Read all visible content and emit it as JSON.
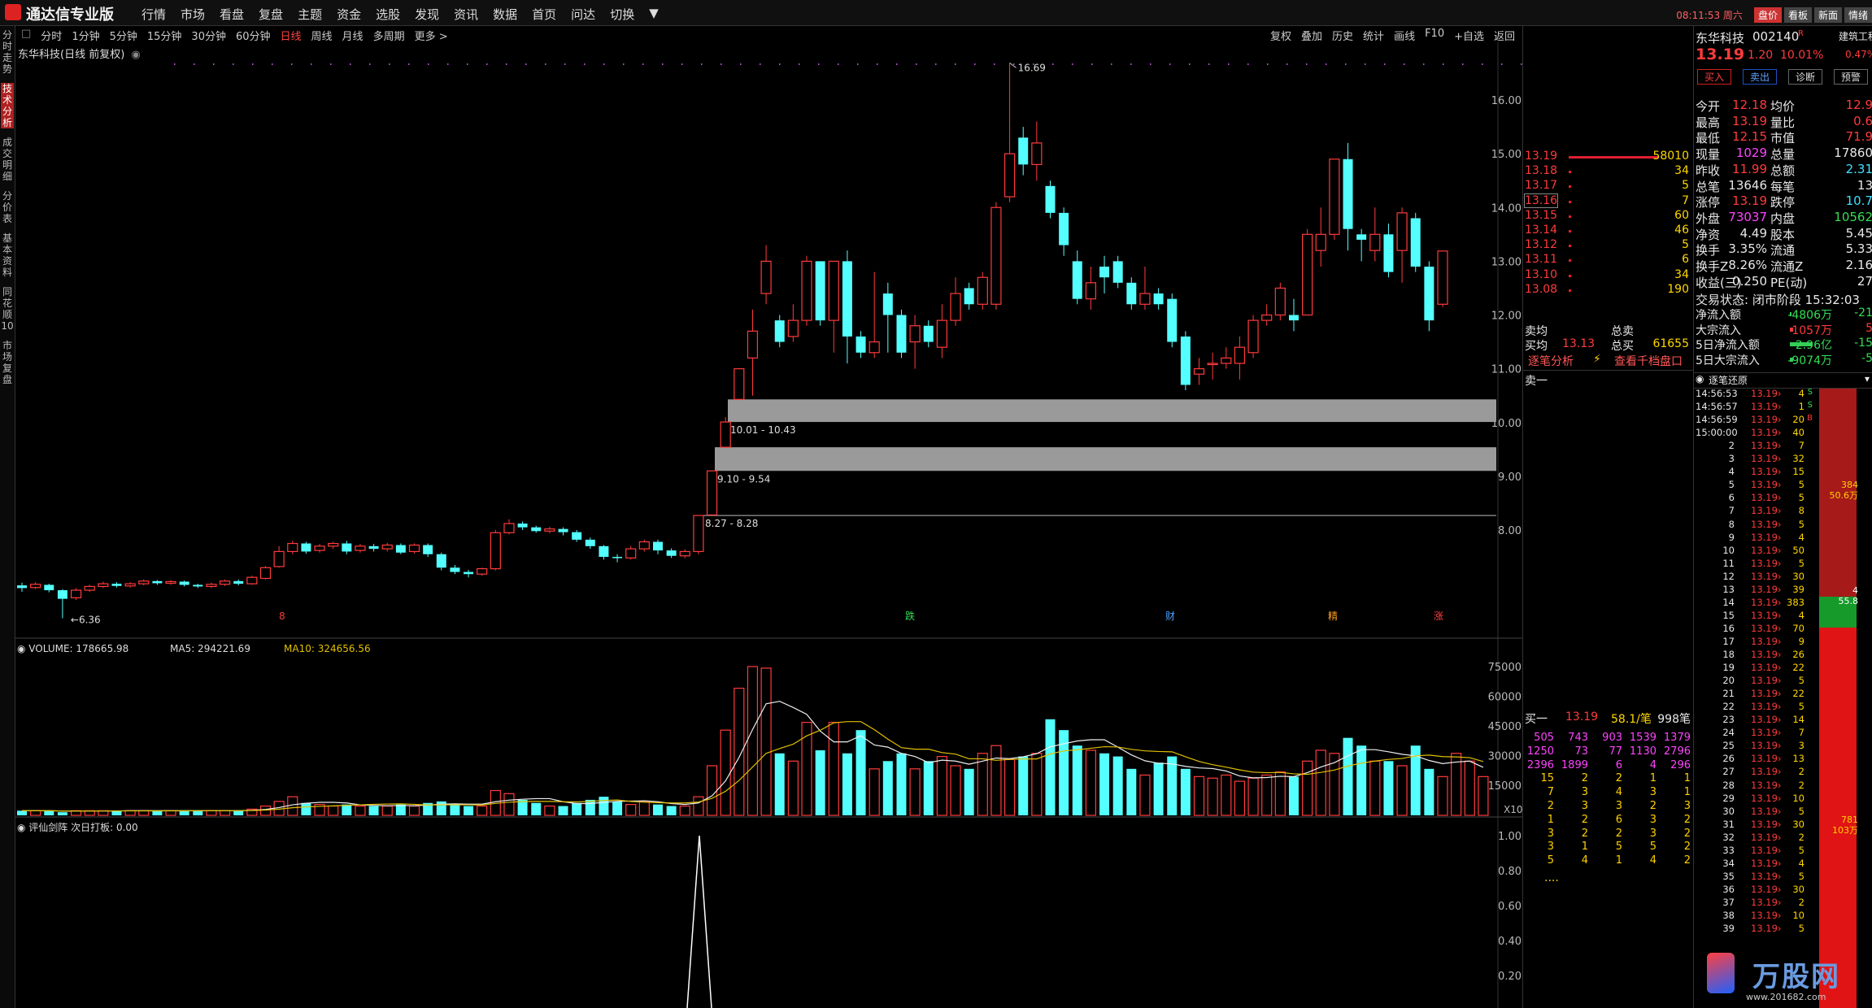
{
  "app": {
    "title": "通达信专业版",
    "menu": [
      "行情",
      "市场",
      "看盘",
      "复盘",
      "主题",
      "资金",
      "选股",
      "发现",
      "资讯",
      "数据",
      "首页",
      "问达",
      "切换",
      "▼"
    ],
    "clock": "08:11:53 周六",
    "top_buttons": [
      "盘价",
      "看板",
      "新面",
      "情绪"
    ]
  },
  "left_tabs": [
    "分时走势",
    "技术分析",
    "成交明细",
    "分价表",
    "基本资料",
    "同花顺10",
    "市场复盘"
  ],
  "periods": [
    "分时",
    "1分钟",
    "5分钟",
    "15分钟",
    "30分钟",
    "60分钟",
    "日线",
    "周线",
    "月线",
    "多周期",
    "更多 >"
  ],
  "active_period": "日线",
  "tools": [
    "复权",
    "叠加",
    "历史",
    "统计",
    "画线",
    "F10",
    "+自选",
    "返回"
  ],
  "chart_title": "东华科技(日线 前复权)",
  "price_axis": [
    "16.00",
    "15.00",
    "14.00",
    "13.00",
    "12.00",
    "11.00",
    "10.00",
    "9.00",
    "8.00"
  ],
  "annotations": {
    "high": "16.69",
    "low": "6.36",
    "gap1": "10.01 - 10.43",
    "gap2": "9.10 - 9.54",
    "gap3": "8.27 - 8.28"
  },
  "event_marks": [
    "8",
    "跌",
    "财",
    "精",
    "涨"
  ],
  "volume": {
    "legend_name": "VOLUME: 178665.98",
    "legend_ma5": "MA5: 294221.69",
    "legend_ma10": "MA10: 324656.56",
    "axis": [
      "75000",
      "60000",
      "45000",
      "30000",
      "15000"
    ],
    "unit": "X10"
  },
  "indicator": {
    "legend": "评仙剑阵  次日打板: 0.00",
    "axis": [
      "1.00",
      "0.80",
      "0.60",
      "0.40",
      "0.20"
    ]
  },
  "quote": {
    "name": "东华科技",
    "code": "002140",
    "code_mark": "R",
    "sector": "建筑工程",
    "price": "13.19",
    "change": "1.20",
    "pct": "10.01%",
    "extra_pct": "0.47%",
    "buttons": [
      "买入",
      "卖出",
      "诊断",
      "预警"
    ],
    "sell_levels": [
      {
        "price": "13.19",
        "vol": "58010"
      },
      {
        "price": "13.18",
        "vol": "34"
      },
      {
        "price": "13.17",
        "vol": "5"
      },
      {
        "price": "13.16",
        "vol": "7"
      },
      {
        "price": "13.15",
        "vol": "60"
      },
      {
        "price": "13.14",
        "vol": "46"
      },
      {
        "price": "13.12",
        "vol": "5"
      },
      {
        "price": "13.11",
        "vol": "6"
      },
      {
        "price": "13.10",
        "vol": "34"
      },
      {
        "price": "13.08",
        "vol": "190"
      }
    ],
    "sell_avg_label": "卖均",
    "sell_total_label": "总卖",
    "buy_avg_label": "买均",
    "buy_avg": "13.13",
    "buy_total_label": "总买",
    "buy_total": "61655",
    "link1": "逐笔分析",
    "link2": "查看千档盘口",
    "ask1_label": "卖一",
    "bid1": {
      "label": "买一",
      "price": "13.19",
      "avg": "58.1/笔",
      "count": "998笔"
    },
    "queue": [
      [
        "505",
        "743",
        "903",
        "1539",
        "1379"
      ],
      [
        "1250",
        "73",
        "77",
        "1130",
        "2796"
      ],
      [
        "2396",
        "1899",
        "6",
        "4",
        "296"
      ],
      [
        "15",
        "2",
        "2",
        "1",
        "1"
      ],
      [
        "7",
        "3",
        "4",
        "3",
        "1"
      ],
      [
        "2",
        "3",
        "3",
        "2",
        "3"
      ],
      [
        "1",
        "2",
        "6",
        "3",
        "2"
      ],
      [
        "3",
        "2",
        "2",
        "3",
        "2"
      ],
      [
        "3",
        "1",
        "5",
        "5",
        "2"
      ],
      [
        "5",
        "4",
        "1",
        "4",
        "2"
      ]
    ],
    "more": "....",
    "stats": [
      {
        "l1": "今开",
        "v1": "12.18",
        "l2": "均价",
        "v2": "12.9"
      },
      {
        "l1": "最高",
        "v1": "13.19",
        "l2": "量比",
        "v2": "0.6"
      },
      {
        "l1": "最低",
        "v1": "12.15",
        "l2": "市值",
        "v2": "71.9"
      },
      {
        "l1": "现量",
        "v1": "1029",
        "l2": "总量",
        "v2": "17860"
      },
      {
        "l1": "昨收",
        "v1": "11.99",
        "l2": "总额",
        "v2": "2.31"
      },
      {
        "l1": "总笔",
        "v1": "13646",
        "l2": "每笔",
        "v2": "13"
      },
      {
        "l1": "涨停",
        "v1": "13.19",
        "l2": "跌停",
        "v2": "10.7"
      },
      {
        "l1": "外盘",
        "v1": "73037",
        "l2": "内盘",
        "v2": "10562"
      },
      {
        "l1": "净资",
        "v1": "4.49",
        "l2": "股本",
        "v2": "5.45"
      },
      {
        "l1": "换手",
        "v1": "3.35%",
        "l2": "流通",
        "v2": "5.33"
      },
      {
        "l1": "换手Z",
        "v1": "8.26%",
        "l2": "流通Z",
        "v2": "2.16"
      },
      {
        "l1": "收益(三)",
        "v1": "0.250",
        "l2": "PE(动)",
        "v2": "27"
      }
    ],
    "trade_status": "交易状态: 闭市阶段 15:32:03",
    "flows": [
      {
        "label": "净流入额",
        "v1": "-4806万",
        "v2": "-21"
      },
      {
        "label": "大宗流入",
        "v1": "1057万",
        "v2": "5"
      },
      {
        "label": "5日净流入额",
        "v1": "-2.96亿",
        "v2": "-15"
      },
      {
        "label": "5日大宗流入",
        "v1": "-9074万",
        "v2": "-5"
      }
    ]
  },
  "ticks": {
    "title": "逐笔还原",
    "rows": [
      [
        "14:56:53",
        "13.19",
        "4",
        "S"
      ],
      [
        "14:56:57",
        "13.19",
        "1",
        "S"
      ],
      [
        "14:56:59",
        "13.19",
        "20",
        "B"
      ],
      [
        "15:00:00",
        "13.19",
        "40",
        ""
      ],
      [
        "2",
        "13.19",
        "7",
        ""
      ],
      [
        "3",
        "13.19",
        "32",
        ""
      ],
      [
        "4",
        "13.19",
        "15",
        ""
      ],
      [
        "5",
        "13.19",
        "5",
        ""
      ],
      [
        "6",
        "13.19",
        "5",
        ""
      ],
      [
        "7",
        "13.19",
        "8",
        ""
      ],
      [
        "8",
        "13.19",
        "5",
        ""
      ],
      [
        "9",
        "13.19",
        "4",
        ""
      ],
      [
        "10",
        "13.19",
        "50",
        ""
      ],
      [
        "11",
        "13.19",
        "5",
        ""
      ],
      [
        "12",
        "13.19",
        "30",
        ""
      ],
      [
        "13",
        "13.19",
        "39",
        ""
      ],
      [
        "14",
        "13.19",
        "383",
        ""
      ],
      [
        "15",
        "13.19",
        "4",
        ""
      ],
      [
        "16",
        "13.19",
        "70",
        ""
      ],
      [
        "17",
        "13.19",
        "9",
        ""
      ],
      [
        "18",
        "13.19",
        "26",
        ""
      ],
      [
        "19",
        "13.19",
        "22",
        ""
      ],
      [
        "20",
        "13.19",
        "5",
        ""
      ],
      [
        "21",
        "13.19",
        "22",
        ""
      ],
      [
        "22",
        "13.19",
        "5",
        ""
      ],
      [
        "23",
        "13.19",
        "14",
        ""
      ],
      [
        "24",
        "13.19",
        "7",
        ""
      ],
      [
        "25",
        "13.19",
        "3",
        ""
      ],
      [
        "26",
        "13.19",
        "13",
        ""
      ],
      [
        "27",
        "13.19",
        "2",
        ""
      ],
      [
        "28",
        "13.19",
        "2",
        ""
      ],
      [
        "29",
        "13.19",
        "10",
        ""
      ],
      [
        "30",
        "13.19",
        "5",
        ""
      ],
      [
        "31",
        "13.19",
        "30",
        ""
      ],
      [
        "32",
        "13.19",
        "2",
        ""
      ],
      [
        "33",
        "13.19",
        "5",
        ""
      ],
      [
        "34",
        "13.19",
        "4",
        ""
      ],
      [
        "35",
        "13.19",
        "5",
        ""
      ],
      [
        "36",
        "13.19",
        "30",
        ""
      ],
      [
        "37",
        "13.19",
        "2",
        ""
      ],
      [
        "38",
        "13.19",
        "10",
        ""
      ],
      [
        "39",
        "13.19",
        "5",
        ""
      ]
    ],
    "bar_labels": [
      {
        "v": "384",
        "s": "50.6万"
      },
      {
        "v": "4",
        "s": "55.8"
      },
      {
        "v": "781",
        "s": "103万"
      }
    ],
    "watermark": "万股网",
    "watermark_url": "www.201682.com"
  },
  "candles": [
    {
      "o": 6.97,
      "c": 6.92,
      "h": 7.02,
      "l": 6.85
    },
    {
      "o": 6.93,
      "c": 6.99,
      "h": 7.03,
      "l": 6.9
    },
    {
      "o": 6.98,
      "c": 6.88,
      "h": 7.0,
      "l": 6.84
    },
    {
      "o": 6.88,
      "c": 6.72,
      "h": 6.9,
      "l": 6.36
    },
    {
      "o": 6.74,
      "c": 6.88,
      "h": 6.92,
      "l": 6.7
    },
    {
      "o": 6.88,
      "c": 6.95,
      "h": 6.98,
      "l": 6.85
    },
    {
      "o": 6.95,
      "c": 7.0,
      "h": 7.04,
      "l": 6.92
    },
    {
      "o": 7.0,
      "c": 6.96,
      "h": 7.03,
      "l": 6.93
    },
    {
      "o": 6.96,
      "c": 7.0,
      "h": 7.03,
      "l": 6.93
    },
    {
      "o": 7.0,
      "c": 7.05,
      "h": 7.08,
      "l": 6.97
    },
    {
      "o": 7.05,
      "c": 7.01,
      "h": 7.07,
      "l": 6.98
    },
    {
      "o": 7.01,
      "c": 7.04,
      "h": 7.07,
      "l": 6.98
    },
    {
      "o": 7.04,
      "c": 6.98,
      "h": 7.06,
      "l": 6.95
    },
    {
      "o": 6.98,
      "c": 6.95,
      "h": 7.0,
      "l": 6.92
    },
    {
      "o": 6.95,
      "c": 6.99,
      "h": 7.02,
      "l": 6.92
    },
    {
      "o": 6.99,
      "c": 7.05,
      "h": 7.08,
      "l": 6.96
    },
    {
      "o": 7.05,
      "c": 7.0,
      "h": 7.08,
      "l": 6.97
    },
    {
      "o": 7.0,
      "c": 7.12,
      "h": 7.15,
      "l": 6.98
    },
    {
      "o": 7.1,
      "c": 7.3,
      "h": 7.33,
      "l": 7.08
    },
    {
      "o": 7.32,
      "c": 7.6,
      "h": 7.7,
      "l": 7.3
    },
    {
      "o": 7.6,
      "c": 7.75,
      "h": 7.8,
      "l": 7.55
    },
    {
      "o": 7.75,
      "c": 7.6,
      "h": 7.78,
      "l": 7.56
    },
    {
      "o": 7.62,
      "c": 7.7,
      "h": 7.74,
      "l": 7.58
    },
    {
      "o": 7.7,
      "c": 7.75,
      "h": 7.78,
      "l": 7.65
    },
    {
      "o": 7.75,
      "c": 7.6,
      "h": 7.8,
      "l": 7.55
    },
    {
      "o": 7.62,
      "c": 7.7,
      "h": 7.74,
      "l": 7.58
    },
    {
      "o": 7.7,
      "c": 7.65,
      "h": 7.74,
      "l": 7.6
    },
    {
      "o": 7.65,
      "c": 7.72,
      "h": 7.76,
      "l": 7.6
    },
    {
      "o": 7.72,
      "c": 7.58,
      "h": 7.75,
      "l": 7.55
    },
    {
      "o": 7.6,
      "c": 7.72,
      "h": 7.75,
      "l": 7.56
    },
    {
      "o": 7.72,
      "c": 7.55,
      "h": 7.75,
      "l": 7.5
    },
    {
      "o": 7.55,
      "c": 7.3,
      "h": 7.58,
      "l": 7.25
    },
    {
      "o": 7.3,
      "c": 7.22,
      "h": 7.35,
      "l": 7.18
    },
    {
      "o": 7.22,
      "c": 7.18,
      "h": 7.26,
      "l": 7.12
    },
    {
      "o": 7.18,
      "c": 7.28,
      "h": 7.3,
      "l": 7.15
    },
    {
      "o": 7.28,
      "c": 7.95,
      "h": 8.0,
      "l": 7.25
    },
    {
      "o": 7.95,
      "c": 8.12,
      "h": 8.2,
      "l": 7.92
    },
    {
      "o": 8.12,
      "c": 8.05,
      "h": 8.16,
      "l": 8.0
    },
    {
      "o": 8.05,
      "c": 7.98,
      "h": 8.08,
      "l": 7.95
    },
    {
      "o": 7.98,
      "c": 8.02,
      "h": 8.06,
      "l": 7.94
    },
    {
      "o": 8.02,
      "c": 7.96,
      "h": 8.05,
      "l": 7.9
    },
    {
      "o": 7.96,
      "c": 7.82,
      "h": 8.0,
      "l": 7.78
    },
    {
      "o": 7.82,
      "c": 7.7,
      "h": 7.86,
      "l": 7.65
    },
    {
      "o": 7.7,
      "c": 7.5,
      "h": 7.72,
      "l": 7.45
    },
    {
      "o": 7.5,
      "c": 7.48,
      "h": 7.55,
      "l": 7.4
    },
    {
      "o": 7.48,
      "c": 7.65,
      "h": 7.7,
      "l": 7.45
    },
    {
      "o": 7.65,
      "c": 7.78,
      "h": 7.82,
      "l": 7.6
    },
    {
      "o": 7.78,
      "c": 7.62,
      "h": 7.82,
      "l": 7.55
    },
    {
      "o": 7.62,
      "c": 7.52,
      "h": 7.66,
      "l": 7.48
    },
    {
      "o": 7.52,
      "c": 7.6,
      "h": 7.64,
      "l": 7.48
    },
    {
      "o": 7.6,
      "c": 8.27,
      "h": 8.27,
      "l": 7.55
    },
    {
      "o": 8.28,
      "c": 9.1,
      "h": 9.1,
      "l": 8.28
    },
    {
      "o": 9.54,
      "c": 10.01,
      "h": 10.1,
      "l": 9.54
    },
    {
      "o": 10.43,
      "c": 11.0,
      "h": 11.0,
      "l": 10.43
    },
    {
      "o": 11.2,
      "c": 11.7,
      "h": 12.1,
      "l": 10.5
    },
    {
      "o": 12.4,
      "c": 13.0,
      "h": 13.3,
      "l": 12.2
    },
    {
      "o": 11.9,
      "c": 11.5,
      "h": 12.0,
      "l": 11.4
    },
    {
      "o": 11.6,
      "c": 11.9,
      "h": 12.2,
      "l": 11.5
    },
    {
      "o": 11.9,
      "c": 13.0,
      "h": 13.1,
      "l": 11.8
    },
    {
      "o": 13.0,
      "c": 11.9,
      "h": 13.0,
      "l": 11.8
    },
    {
      "o": 11.9,
      "c": 13.0,
      "h": 13.0,
      "l": 11.3
    },
    {
      "o": 13.0,
      "c": 11.6,
      "h": 13.2,
      "l": 11.1
    },
    {
      "o": 11.6,
      "c": 11.3,
      "h": 11.7,
      "l": 11.2
    },
    {
      "o": 11.3,
      "c": 11.5,
      "h": 12.8,
      "l": 11.2
    },
    {
      "o": 12.4,
      "c": 12.0,
      "h": 12.6,
      "l": 11.3
    },
    {
      "o": 12.0,
      "c": 11.3,
      "h": 12.1,
      "l": 11.2
    },
    {
      "o": 11.5,
      "c": 11.8,
      "h": 12.0,
      "l": 11.0
    },
    {
      "o": 11.8,
      "c": 11.5,
      "h": 11.9,
      "l": 11.4
    },
    {
      "o": 11.4,
      "c": 11.9,
      "h": 12.2,
      "l": 11.2
    },
    {
      "o": 11.9,
      "c": 12.4,
      "h": 12.7,
      "l": 11.8
    },
    {
      "o": 12.5,
      "c": 12.2,
      "h": 12.6,
      "l": 12.1
    },
    {
      "o": 12.2,
      "c": 12.7,
      "h": 12.8,
      "l": 12.1
    },
    {
      "o": 12.2,
      "c": 14.0,
      "h": 14.1,
      "l": 12.1
    },
    {
      "o": 14.2,
      "c": 15.0,
      "h": 16.69,
      "l": 14.1
    },
    {
      "o": 15.3,
      "c": 14.8,
      "h": 15.5,
      "l": 14.6
    },
    {
      "o": 14.8,
      "c": 15.2,
      "h": 15.6,
      "l": 14.5
    },
    {
      "o": 14.4,
      "c": 13.9,
      "h": 14.5,
      "l": 13.8
    },
    {
      "o": 13.9,
      "c": 13.3,
      "h": 14.0,
      "l": 13.1
    },
    {
      "o": 13.0,
      "c": 12.3,
      "h": 13.2,
      "l": 12.2
    },
    {
      "o": 12.3,
      "c": 12.6,
      "h": 12.9,
      "l": 12.1
    },
    {
      "o": 12.9,
      "c": 12.7,
      "h": 13.1,
      "l": 12.4
    },
    {
      "o": 13.0,
      "c": 12.6,
      "h": 13.1,
      "l": 12.5
    },
    {
      "o": 12.6,
      "c": 12.2,
      "h": 12.7,
      "l": 12.1
    },
    {
      "o": 12.2,
      "c": 12.4,
      "h": 12.9,
      "l": 12.1
    },
    {
      "o": 12.4,
      "c": 12.2,
      "h": 12.5,
      "l": 12.1
    },
    {
      "o": 12.3,
      "c": 11.5,
      "h": 12.4,
      "l": 11.4
    },
    {
      "o": 11.6,
      "c": 10.7,
      "h": 11.7,
      "l": 10.6
    },
    {
      "o": 10.9,
      "c": 11.0,
      "h": 11.2,
      "l": 10.7
    },
    {
      "o": 11.1,
      "c": 11.1,
      "h": 11.3,
      "l": 10.8
    },
    {
      "o": 11.1,
      "c": 11.2,
      "h": 11.4,
      "l": 11.0
    },
    {
      "o": 11.1,
      "c": 11.4,
      "h": 11.6,
      "l": 10.8
    },
    {
      "o": 11.3,
      "c": 11.9,
      "h": 12.0,
      "l": 11.2
    },
    {
      "o": 11.9,
      "c": 12.0,
      "h": 12.2,
      "l": 11.8
    },
    {
      "o": 12.0,
      "c": 12.5,
      "h": 12.6,
      "l": 11.9
    },
    {
      "o": 12.0,
      "c": 11.9,
      "h": 12.3,
      "l": 11.7
    },
    {
      "o": 12.0,
      "c": 13.5,
      "h": 13.6,
      "l": 12.0
    },
    {
      "o": 13.2,
      "c": 13.5,
      "h": 14.0,
      "l": 12.9
    },
    {
      "o": 13.5,
      "c": 14.9,
      "h": 14.9,
      "l": 13.4
    },
    {
      "o": 14.9,
      "c": 13.6,
      "h": 15.2,
      "l": 13.2
    },
    {
      "o": 13.5,
      "c": 13.4,
      "h": 13.6,
      "l": 13.0
    },
    {
      "o": 13.2,
      "c": 13.5,
      "h": 14.0,
      "l": 13.0
    },
    {
      "o": 13.5,
      "c": 12.8,
      "h": 13.7,
      "l": 12.7
    },
    {
      "o": 13.2,
      "c": 13.9,
      "h": 14.0,
      "l": 12.6
    },
    {
      "o": 13.8,
      "c": 12.9,
      "h": 13.9,
      "l": 12.8
    },
    {
      "o": 12.9,
      "c": 11.9,
      "h": 13.0,
      "l": 11.7
    },
    {
      "o": 12.2,
      "c": 13.19,
      "h": 13.19,
      "l": 12.15
    }
  ],
  "volumes": [
    3,
    3,
    3,
    2,
    3,
    3,
    3,
    3,
    3,
    3,
    3,
    3,
    3,
    3,
    3,
    3,
    3,
    4,
    6,
    9,
    12,
    8,
    7,
    6,
    7,
    6,
    6,
    6,
    7,
    6,
    8,
    9,
    7,
    6,
    6,
    16,
    14,
    10,
    8,
    6,
    6,
    8,
    10,
    12,
    9,
    7,
    9,
    7,
    6,
    6,
    12,
    32,
    55,
    82,
    96,
    95,
    40,
    35,
    60,
    42,
    60,
    40,
    55,
    30,
    35,
    40,
    30,
    35,
    38,
    32,
    30,
    40,
    45,
    36,
    38,
    40,
    62,
    55,
    45,
    42,
    40,
    38,
    30,
    26,
    34,
    38,
    30,
    25,
    24,
    26,
    22,
    24,
    26,
    28,
    25,
    35,
    42,
    40,
    50,
    45,
    35,
    35,
    32,
    45,
    30,
    25,
    40,
    35,
    25
  ]
}
